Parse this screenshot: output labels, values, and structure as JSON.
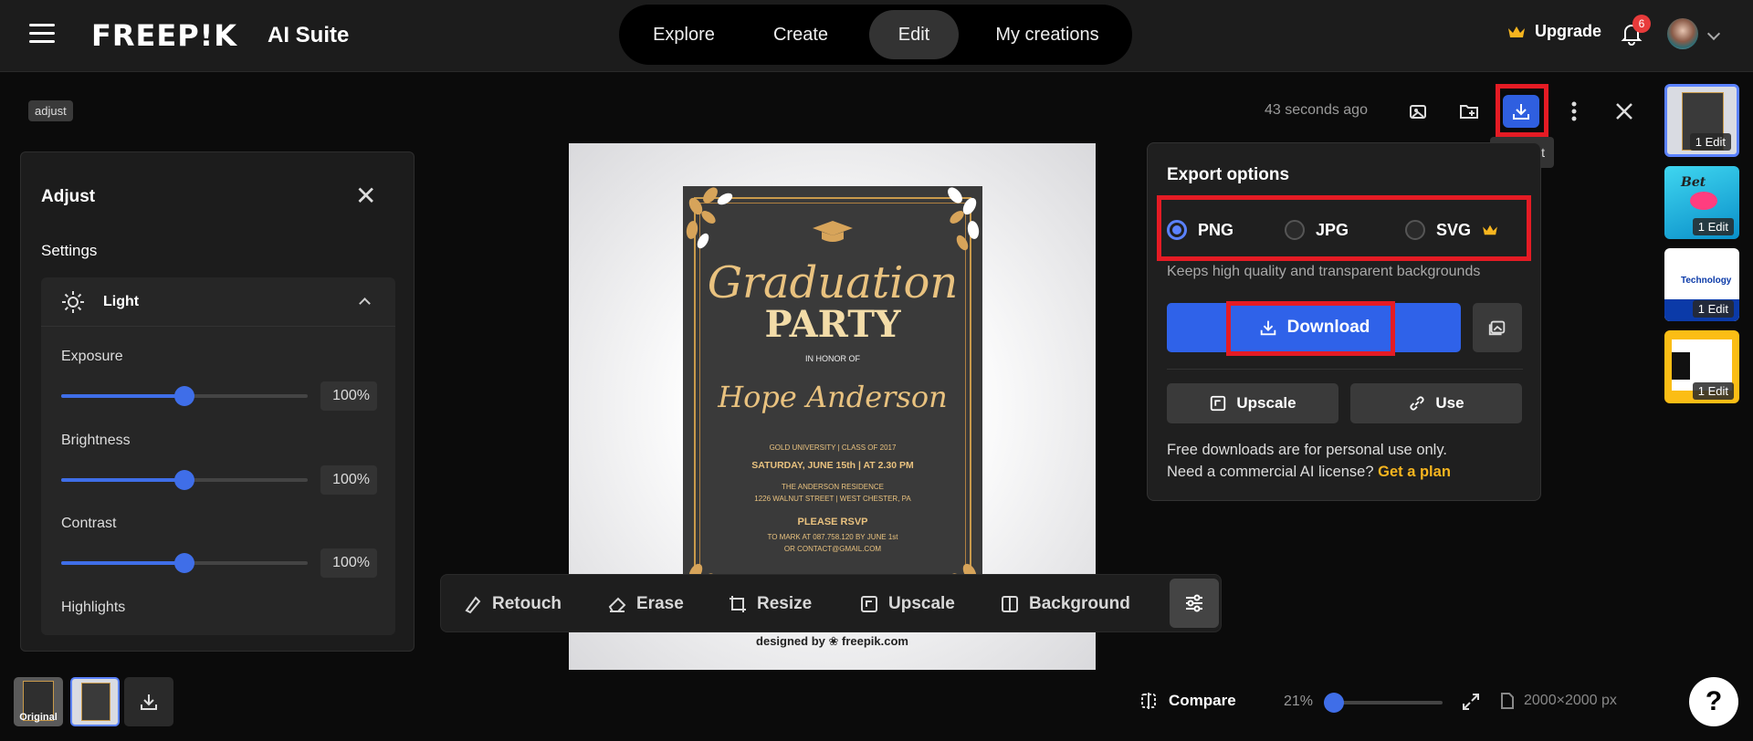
{
  "header": {
    "brand": "FREEP!K",
    "suite": "AI Suite",
    "nav": [
      {
        "label": "Explore"
      },
      {
        "label": "Create"
      },
      {
        "label": "Edit"
      },
      {
        "label": "My creations"
      }
    ],
    "active_nav": "Edit",
    "upgrade_label": "Upgrade",
    "notification_count": "6",
    "accent_color": "#2f62e9",
    "gold_color": "#f7b51f"
  },
  "editor": {
    "tag": "adjust",
    "time_ago": "43 seconds ago",
    "tooltip": "t"
  },
  "adjust_panel": {
    "title": "Adjust",
    "settings_label": "Settings",
    "section": "Light",
    "sliders": [
      {
        "name": "Exposure",
        "value": "100",
        "unit": "%",
        "position": 0.5
      },
      {
        "name": "Brightness",
        "value": "100",
        "unit": "%",
        "position": 0.5
      },
      {
        "name": "Contrast",
        "value": "100",
        "unit": "%",
        "position": 0.5
      },
      {
        "name": "Highlights"
      }
    ]
  },
  "image": {
    "title_script": "Graduation",
    "title_main": "PARTY",
    "honor": "IN HONOR OF",
    "name": "Hope Anderson",
    "line1": "GOLD UNIVERSITY | CLASS OF 2017",
    "line2": "SATURDAY, JUNE 15th | AT 2.30 PM",
    "line3": "THE ANDERSON RESIDENCE",
    "line4": "1226 WALNUT STREET | WEST CHESTER, PA",
    "line5": "PLEASE RSVP",
    "line6": "TO MARK AT 087.758.120 BY JUNE 1st",
    "line7": "OR CONTACT@GMAIL.COM",
    "credit": "designed by ❀ freepik.com"
  },
  "toolbar": {
    "tools": [
      {
        "label": "Retouch"
      },
      {
        "label": "Erase"
      },
      {
        "label": "Resize"
      },
      {
        "label": "Upscale"
      },
      {
        "label": "Background"
      }
    ]
  },
  "export": {
    "title": "Export options",
    "formats": [
      {
        "label": "PNG",
        "selected": true
      },
      {
        "label": "JPG",
        "selected": false
      },
      {
        "label": "SVG",
        "selected": false
      }
    ],
    "description": "Keeps high quality and transparent backgrounds",
    "download_label": "Download",
    "upscale_label": "Upscale",
    "use_label": "Use",
    "footer_line1": "Free downloads are for personal use only.",
    "footer_line2": "Need a commercial AI license?",
    "plan_link": "Get a plan"
  },
  "history": {
    "thumbs": [
      {
        "edit_label": "1 Edit"
      },
      {
        "edit_label": "1 Edit",
        "mini_text": "Bet"
      },
      {
        "edit_label": "1 Edit",
        "mini_text": "Technology"
      },
      {
        "edit_label": "1 Edit"
      }
    ]
  },
  "bottom": {
    "original_label": "Original",
    "compare_label": "Compare",
    "zoom": "21%",
    "dimensions": "2000×2000 px",
    "help": "?"
  }
}
